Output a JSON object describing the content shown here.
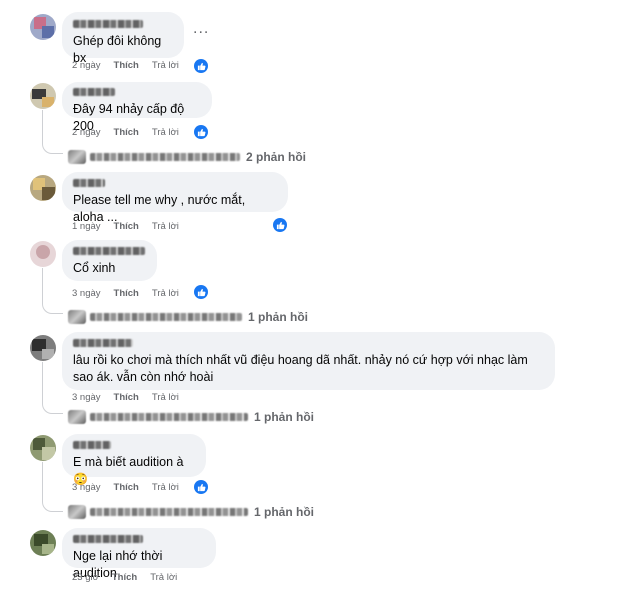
{
  "comments": [
    {
      "text": "Ghép đôi không bx",
      "time": "2 ngày",
      "like": "Thích",
      "reply": "Trả lời"
    },
    {
      "text": "Đây 94 nhảy cấp độ 200",
      "time": "2 ngày",
      "like": "Thích",
      "reply": "Trả lời",
      "replies": "2 phản hồi"
    },
    {
      "text": "Please tell me why , nước mắt, aloha ...",
      "time": "1 ngày",
      "like": "Thích",
      "reply": "Trả lời"
    },
    {
      "text": "Cổ xinh",
      "time": "3 ngày",
      "like": "Thích",
      "reply": "Trả lời",
      "replies": "1 phản hồi"
    },
    {
      "text": "lâu rồi ko chơi mà thích nhất vũ điệu hoang dã nhất. nhảy nó cứ hợp với nhạc làm sao ák. vẫn còn nhớ hoài",
      "time": "3 ngày",
      "like": "Thích",
      "reply": "Trả lời",
      "replies": "1 phản hồi"
    },
    {
      "text": "E mà biết audition à",
      "time": "3 ngày",
      "like": "Thích",
      "reply": "Trả lời",
      "replies": "1 phản hồi"
    },
    {
      "text": "Nge lại nhớ thời audition",
      "time": "23 giờ",
      "like": "Thích",
      "reply": "Trả lời"
    }
  ],
  "more": "...",
  "emoji": "😳",
  "colors": {
    "like_blue": "#1877f2",
    "bubble": "#f0f2f5",
    "meta": "#65676b"
  }
}
